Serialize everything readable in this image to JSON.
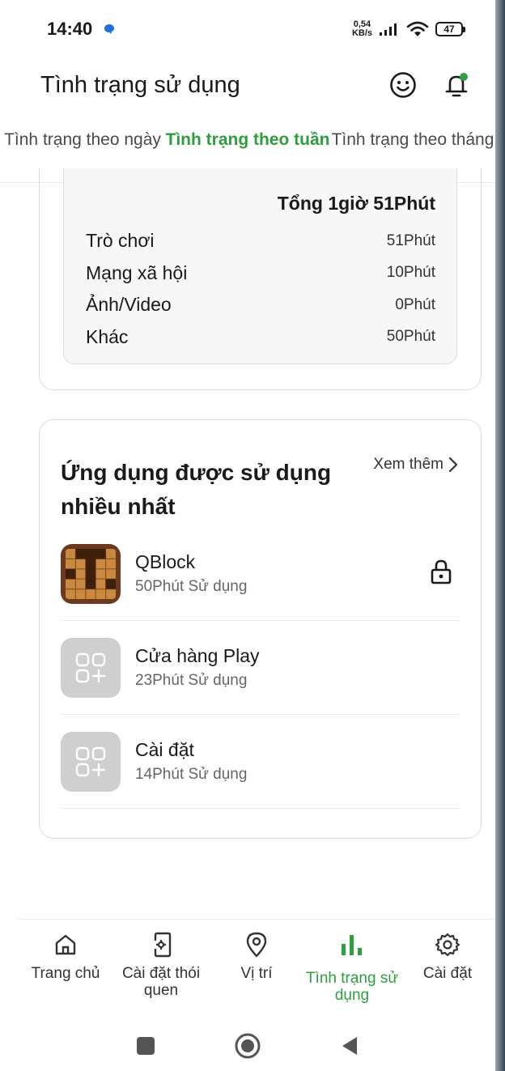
{
  "status_bar": {
    "time": "14:40",
    "net_speed_value": "0,54",
    "net_speed_unit": "KB/s",
    "battery": "47"
  },
  "app_bar": {
    "title": "Tình trạng sử dụng"
  },
  "tabs": [
    {
      "label": "Tình trạng theo ngày",
      "active": false
    },
    {
      "label": "Tình trạng theo tuần",
      "active": true
    },
    {
      "label": "Tình trạng theo tháng",
      "active": false
    }
  ],
  "usage_summary": {
    "total": "Tổng 1giờ 51Phút",
    "categories": [
      {
        "name": "Trò chơi",
        "value": "51Phút"
      },
      {
        "name": "Mạng xã hội",
        "value": "10Phút"
      },
      {
        "name": "Ảnh/Video",
        "value": "0Phút"
      },
      {
        "name": "Khác",
        "value": "50Phút"
      }
    ]
  },
  "most_used": {
    "title": "Ứng dụng được sử dụng nhiều nhất",
    "see_more": "Xem thêm",
    "apps": [
      {
        "name": "QBlock",
        "usage": "50Phút Sử dụng",
        "icon": "qblock-icon",
        "locked": true
      },
      {
        "name": "Cửa hàng Play",
        "usage": "23Phút Sử dụng",
        "icon": "app-placeholder-icon",
        "locked": false
      },
      {
        "name": "Cài đặt",
        "usage": "14Phút Sử dụng",
        "icon": "app-placeholder-icon",
        "locked": false
      }
    ]
  },
  "bottom_nav": [
    {
      "label": "Trang chủ",
      "icon": "home-icon",
      "active": false
    },
    {
      "label": "Cài đặt thói quen",
      "icon": "phone-settings-icon",
      "active": false
    },
    {
      "label": "Vị trí",
      "icon": "location-pin-icon",
      "active": false
    },
    {
      "label": "Tình trạng sử dụng",
      "icon": "bar-chart-icon",
      "active": true
    },
    {
      "label": "Cài đặt",
      "icon": "gear-icon",
      "active": false
    }
  ],
  "colors": {
    "accent": "#2e9e3e",
    "text": "#1a1a1a",
    "muted": "#666666",
    "placeholder_icon_bg": "#cfcfcf"
  }
}
